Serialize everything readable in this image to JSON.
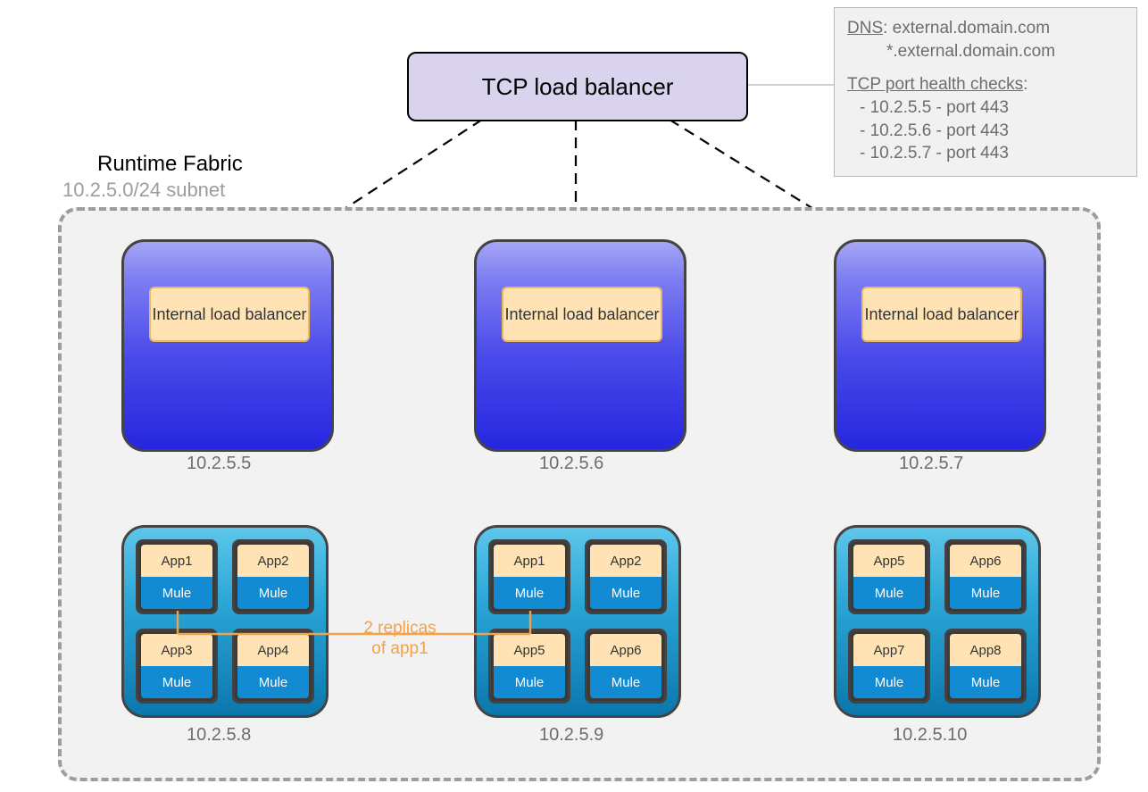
{
  "tcp_lb": {
    "label": "TCP load balancer"
  },
  "info": {
    "dns_label": "DNS",
    "dns_primary": ": external.domain.com",
    "dns_wildcard": "*.external.domain.com",
    "health_label": "TCP port health checks",
    "health_colon": ":",
    "checks": [
      "- 10.2.5.5 - port 443",
      "- 10.2.5.6 - port 443",
      "- 10.2.5.7 - port 443"
    ]
  },
  "rf": {
    "title": "Runtime Fabric",
    "subnet": "10.2.5.0/24 subnet"
  },
  "controllers": [
    {
      "ip": "10.2.5.5",
      "ilb": "Internal load balancer"
    },
    {
      "ip": "10.2.5.6",
      "ilb": "Internal load balancer"
    },
    {
      "ip": "10.2.5.7",
      "ilb": "Internal load balancer"
    }
  ],
  "workers": [
    {
      "ip": "10.2.5.8",
      "apps": [
        {
          "app": "App1",
          "rt": "Mule"
        },
        {
          "app": "App2",
          "rt": "Mule"
        },
        {
          "app": "App3",
          "rt": "Mule"
        },
        {
          "app": "App4",
          "rt": "Mule"
        }
      ]
    },
    {
      "ip": "10.2.5.9",
      "apps": [
        {
          "app": "App1",
          "rt": "Mule"
        },
        {
          "app": "App2",
          "rt": "Mule"
        },
        {
          "app": "App5",
          "rt": "Mule"
        },
        {
          "app": "App6",
          "rt": "Mule"
        }
      ]
    },
    {
      "ip": "10.2.5.10",
      "apps": [
        {
          "app": "App5",
          "rt": "Mule"
        },
        {
          "app": "App6",
          "rt": "Mule"
        },
        {
          "app": "App7",
          "rt": "Mule"
        },
        {
          "app": "App8",
          "rt": "Mule"
        }
      ]
    }
  ],
  "replicas": {
    "line1": "2 replicas",
    "line2": "of app1"
  }
}
